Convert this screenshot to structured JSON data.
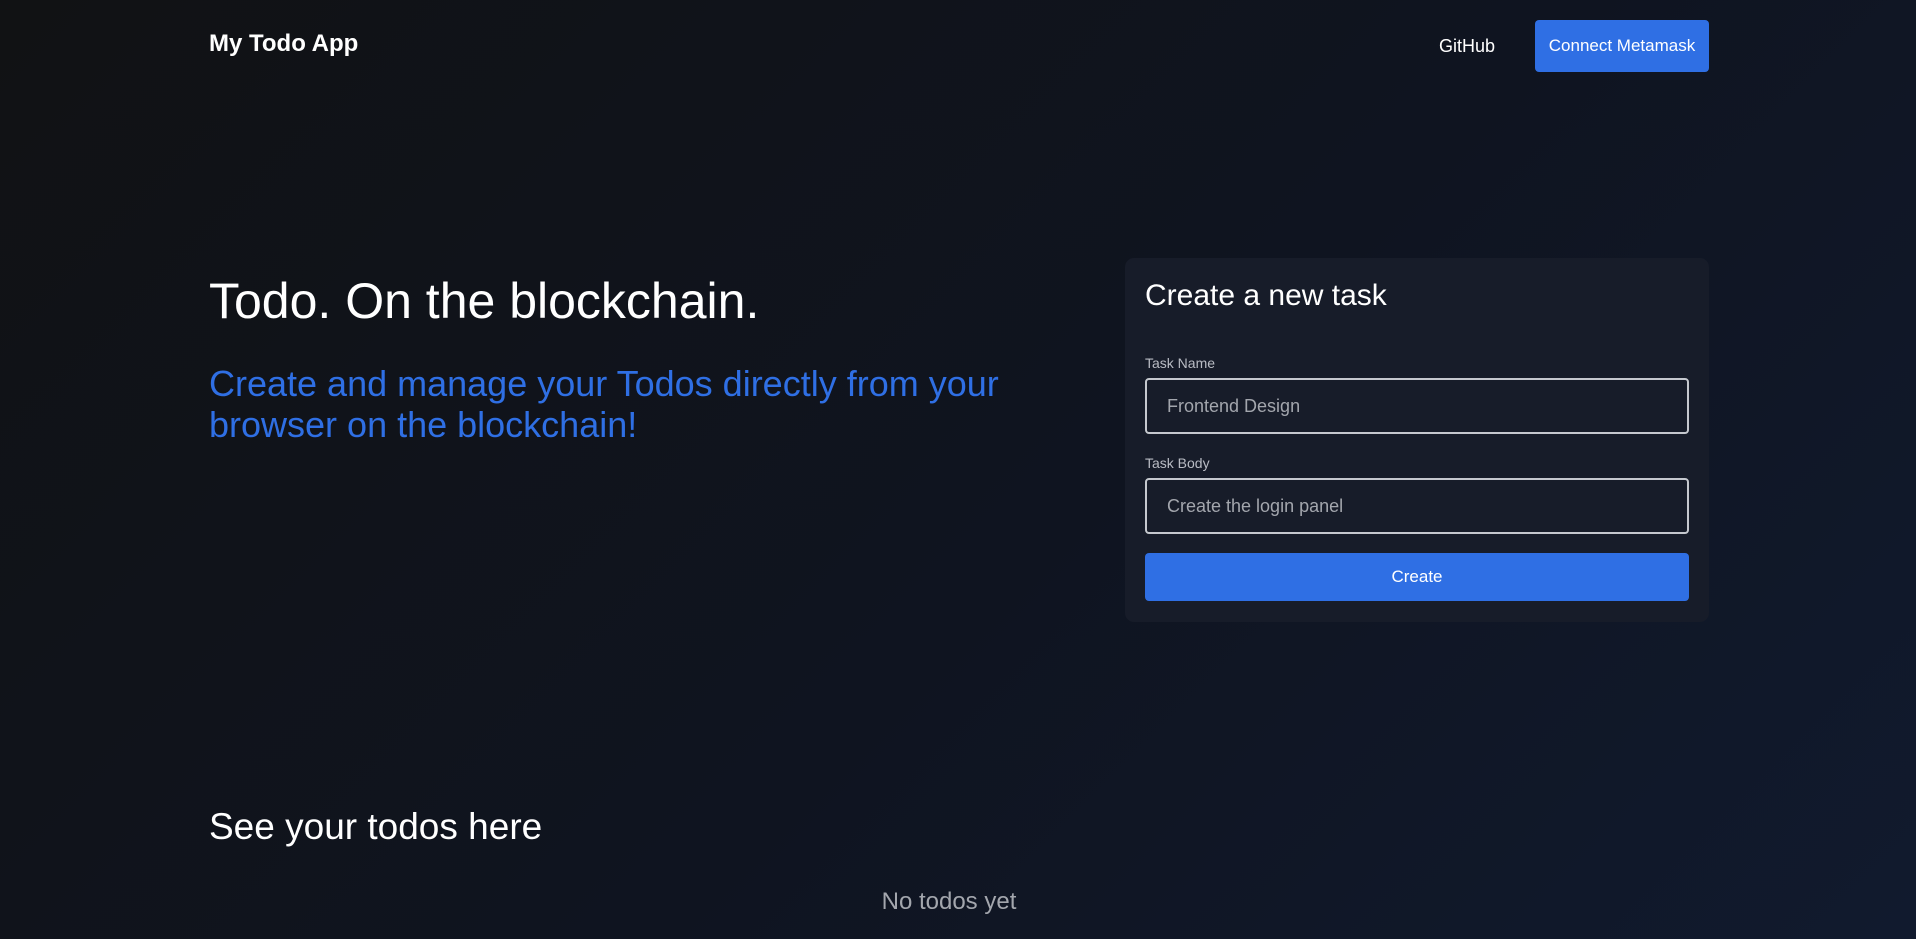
{
  "nav": {
    "brand": "My Todo App",
    "github_label": "GitHub",
    "connect_label": "Connect Metamask"
  },
  "hero": {
    "title": "Todo. On the blockchain.",
    "subtitle": "Create and manage your Todos directly from your browser on the blockchain!"
  },
  "form": {
    "title": "Create a new task",
    "task_name_label": "Task Name",
    "task_name_placeholder": "Frontend Design",
    "task_body_label": "Task Body",
    "task_body_placeholder": "Create the login panel",
    "submit_label": "Create"
  },
  "todos": {
    "title": "See your todos here",
    "empty_text": "No todos yet"
  },
  "colors": {
    "accent": "#2f6fe4",
    "card": "#171c29"
  }
}
